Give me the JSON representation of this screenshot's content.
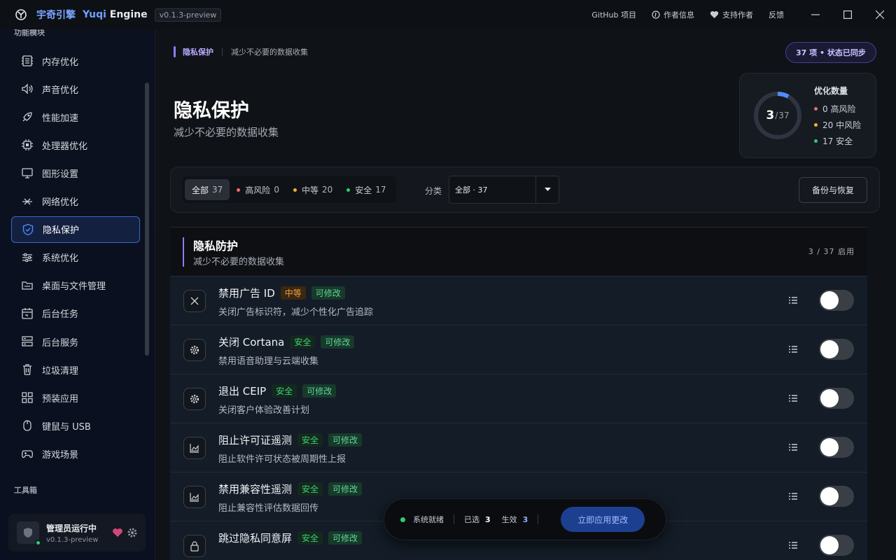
{
  "titlebar": {
    "app_cn": "宇奇引擎",
    "app_en_a": "Yuqi",
    "app_en_b": "Engine",
    "version": "v0.1.3-preview",
    "links": [
      "GitHub 项目",
      "作者信息",
      "支持作者",
      "反馈"
    ]
  },
  "sidebar": {
    "section1": "功能模块",
    "section2": "工具箱",
    "items": [
      "内存优化",
      "声音优化",
      "性能加速",
      "处理器优化",
      "图形设置",
      "网络优化",
      "隐私保护",
      "系统优化",
      "桌面与文件管理",
      "后台任务",
      "后台服务",
      "垃圾清理",
      "预装应用",
      "键鼠与 USB",
      "游戏场景"
    ],
    "active": "隐私保护",
    "user_name": "管理员运行中",
    "user_version": "v0.1.3-preview"
  },
  "breadcrumb": {
    "a": "隐私保护",
    "b": "减少不必要的数据收集"
  },
  "sync_badge": "37 项 • 状态已同步",
  "page": {
    "title": "隐私保护",
    "subtitle": "减少不必要的数据收集"
  },
  "stats": {
    "enabled": 3,
    "total": 37,
    "label": "优化数量",
    "high": "0 高风险",
    "mid": "20 中风险",
    "safe": "17 安全",
    "colors": {
      "high": "#f06a6a",
      "mid": "#f0b429",
      "safe": "#2ecc71",
      "ring": "#4d8dff"
    }
  },
  "filters": {
    "chips": [
      {
        "label": "全部",
        "count": "37"
      },
      {
        "label": "高风险",
        "count": "0"
      },
      {
        "label": "中等",
        "count": "20"
      },
      {
        "label": "安全",
        "count": "17"
      }
    ],
    "category_label": "分类",
    "category_value": "全部 · 37",
    "backup_button": "备份与恢复"
  },
  "section": {
    "title": "隐私防护",
    "subtitle": "减少不必要的数据收集",
    "count": "3 / 37 启用"
  },
  "rows": [
    {
      "title": "禁用广告 ID",
      "level": "中等",
      "editable": "可修改",
      "desc": "关闭广告标识符，减少个性化广告追踪",
      "icon": "close-icon"
    },
    {
      "title": "关闭 Cortana",
      "level": "安全",
      "editable": "可修改",
      "desc": "禁用语音助理与云端收集",
      "icon": "gear-icon"
    },
    {
      "title": "退出 CEIP",
      "level": "安全",
      "editable": "可修改",
      "desc": "关闭客户体验改善计划",
      "icon": "gear-icon"
    },
    {
      "title": "阻止许可证遥测",
      "level": "安全",
      "editable": "可修改",
      "desc": "阻止软件许可状态被周期性上报",
      "icon": "chart-icon"
    },
    {
      "title": "禁用兼容性遥测",
      "level": "安全",
      "editable": "可修改",
      "desc": "阻止兼容性评估数据回传",
      "icon": "chart-icon"
    },
    {
      "title": "跳过隐私同意屏",
      "level": "安全",
      "editable": "可修改",
      "desc": "",
      "icon": "lock-icon"
    }
  ],
  "bottom_bar": {
    "status": "系统就绪",
    "selected_label": "已选",
    "selected": "3",
    "effective_label": "生效",
    "effective": "3",
    "apply_button": "立即应用更改"
  }
}
